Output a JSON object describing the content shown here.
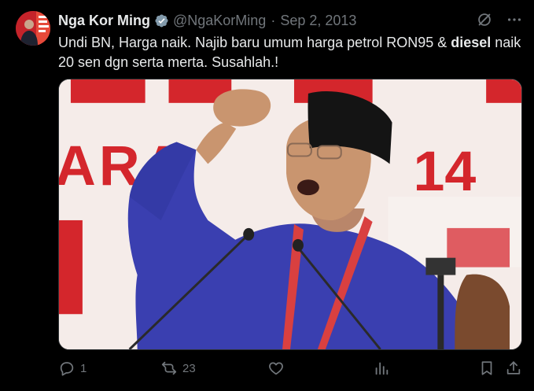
{
  "tweet": {
    "display_name": "Nga Kor Ming",
    "handle": "@NgaKorMing",
    "separator": "·",
    "date": "Sep 2, 2013",
    "text_before": "Undi BN, Harga naik. Najib baru umum harga petrol RON95 & ",
    "text_bold": "diesel",
    "text_after": " naik 20 sen dgn serta merta. Susahlah.!",
    "image_description_icons": [
      "verified-badge-icon",
      "grok-icon",
      "more-icon"
    ]
  },
  "media": {
    "banner_text_left": "ARA",
    "banner_text_right": "14"
  },
  "actions": {
    "reply_count": "1",
    "retweet_count": "23",
    "like_count": "",
    "views_count": ""
  },
  "colors": {
    "background": "#000000",
    "text_primary": "#e7e9ea",
    "text_secondary": "#71767b",
    "verified": "#829aab",
    "banner_red": "#d4262c"
  }
}
